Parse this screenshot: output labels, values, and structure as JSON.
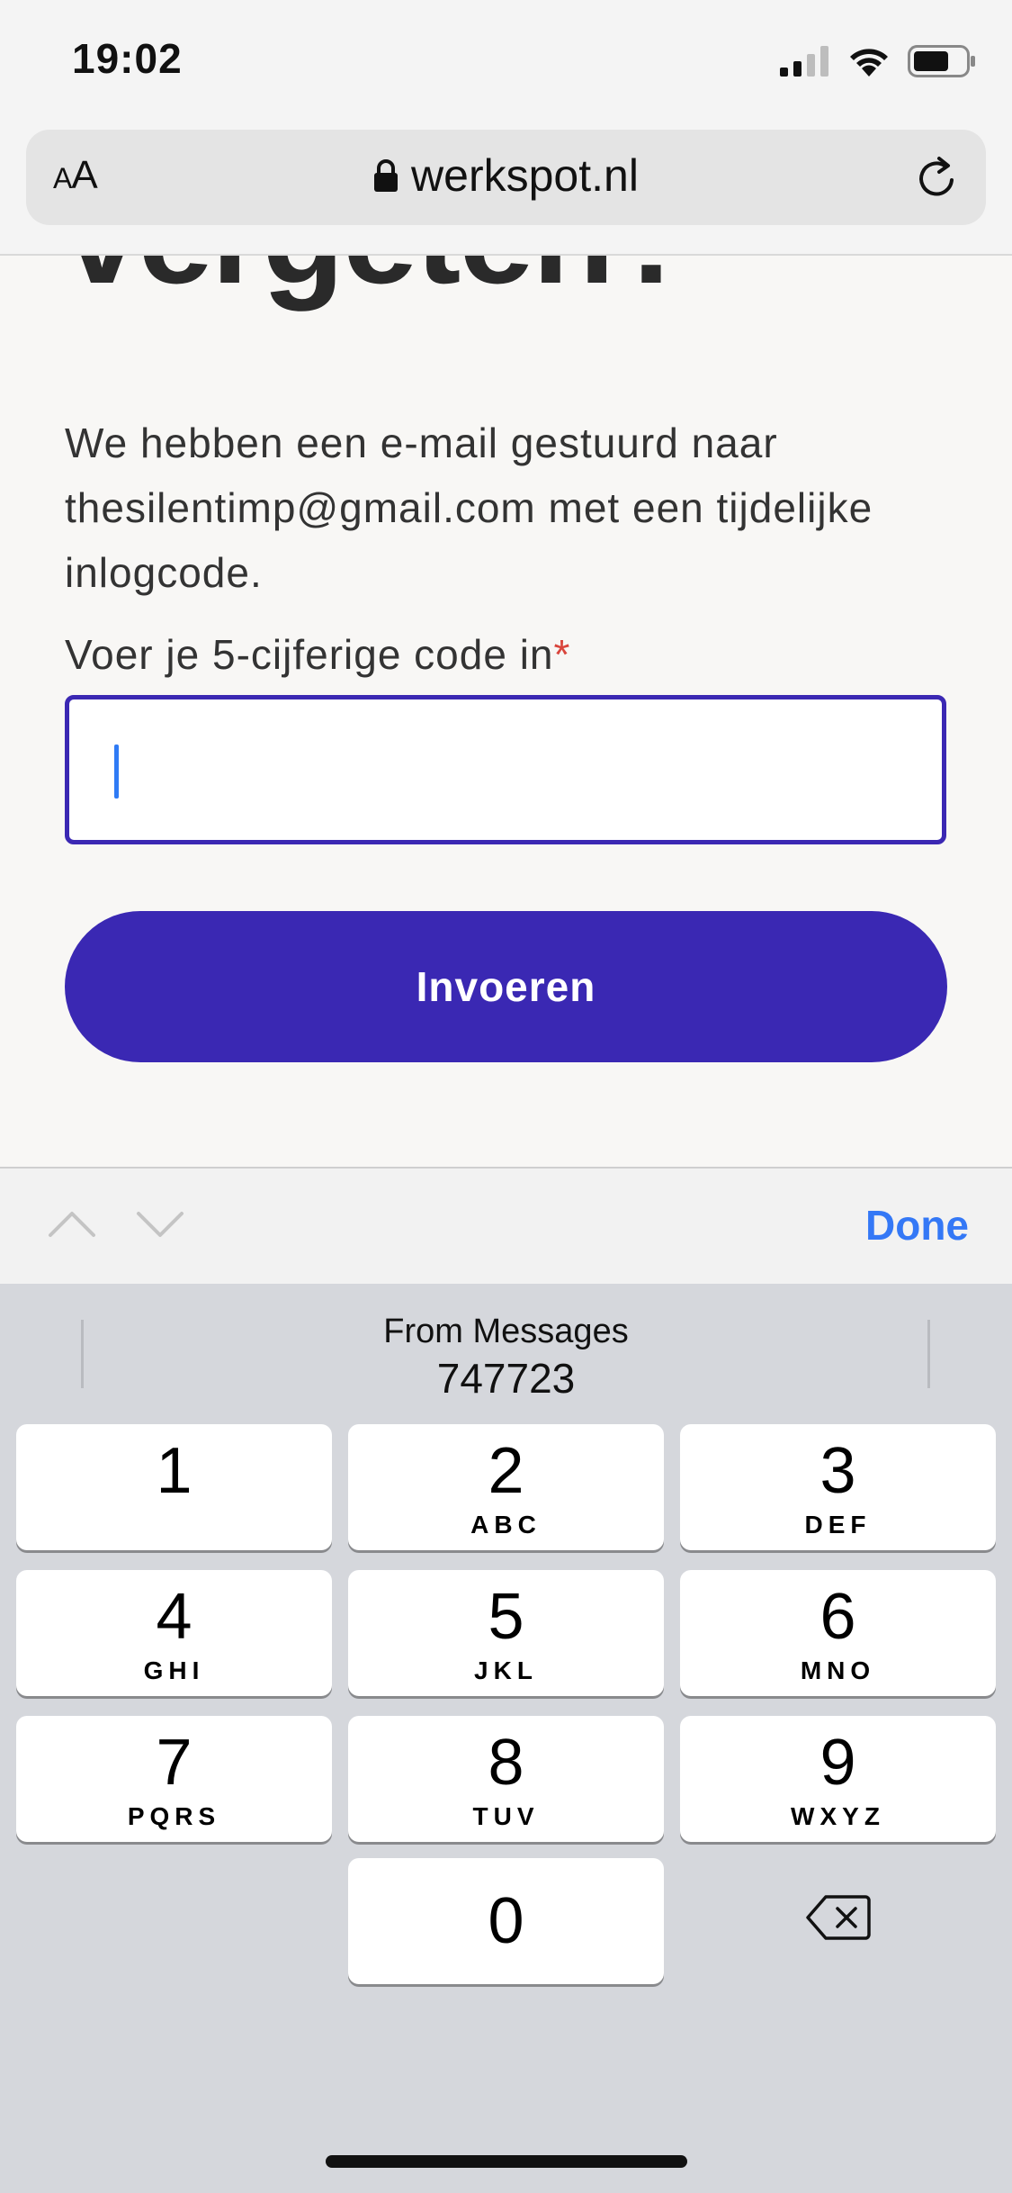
{
  "status_bar": {
    "time": "19:02",
    "icons": [
      "signal-icon",
      "wifi-icon",
      "battery-icon"
    ]
  },
  "browser": {
    "text_size_label": "AA",
    "text_size_small": "A",
    "text_size_large": "A",
    "url": "werkspot.nl",
    "lock_icon": "lock-icon",
    "reload_icon": "reload-icon"
  },
  "page": {
    "title_partial": "vergeten?",
    "description": "We hebben een e-mail gestuurd naar thesilentimp@gmail.com met een tijdelijke inlogcode.",
    "code_label": "Voer je 5-cijferige code in",
    "required_mark": "*",
    "code_value": "",
    "submit_label": "Invoeren"
  },
  "accessory_bar": {
    "prev_icon": "chevron-up-icon",
    "next_icon": "chevron-down-icon",
    "done_label": "Done"
  },
  "keyboard": {
    "suggestion_source": "From Messages",
    "suggestion_code": "747723",
    "keys": [
      {
        "digit": "1",
        "letters": ""
      },
      {
        "digit": "2",
        "letters": "ABC"
      },
      {
        "digit": "3",
        "letters": "DEF"
      },
      {
        "digit": "4",
        "letters": "GHI"
      },
      {
        "digit": "5",
        "letters": "JKL"
      },
      {
        "digit": "6",
        "letters": "MNO"
      },
      {
        "digit": "7",
        "letters": "PQRS"
      },
      {
        "digit": "8",
        "letters": "TUV"
      },
      {
        "digit": "9",
        "letters": "WXYZ"
      },
      {
        "digit": "0",
        "letters": ""
      }
    ],
    "backspace_icon": "backspace-icon"
  },
  "colors": {
    "brand_purple": "#3a28b3",
    "ios_blue": "#3478f6",
    "required_red": "#d9453c"
  }
}
